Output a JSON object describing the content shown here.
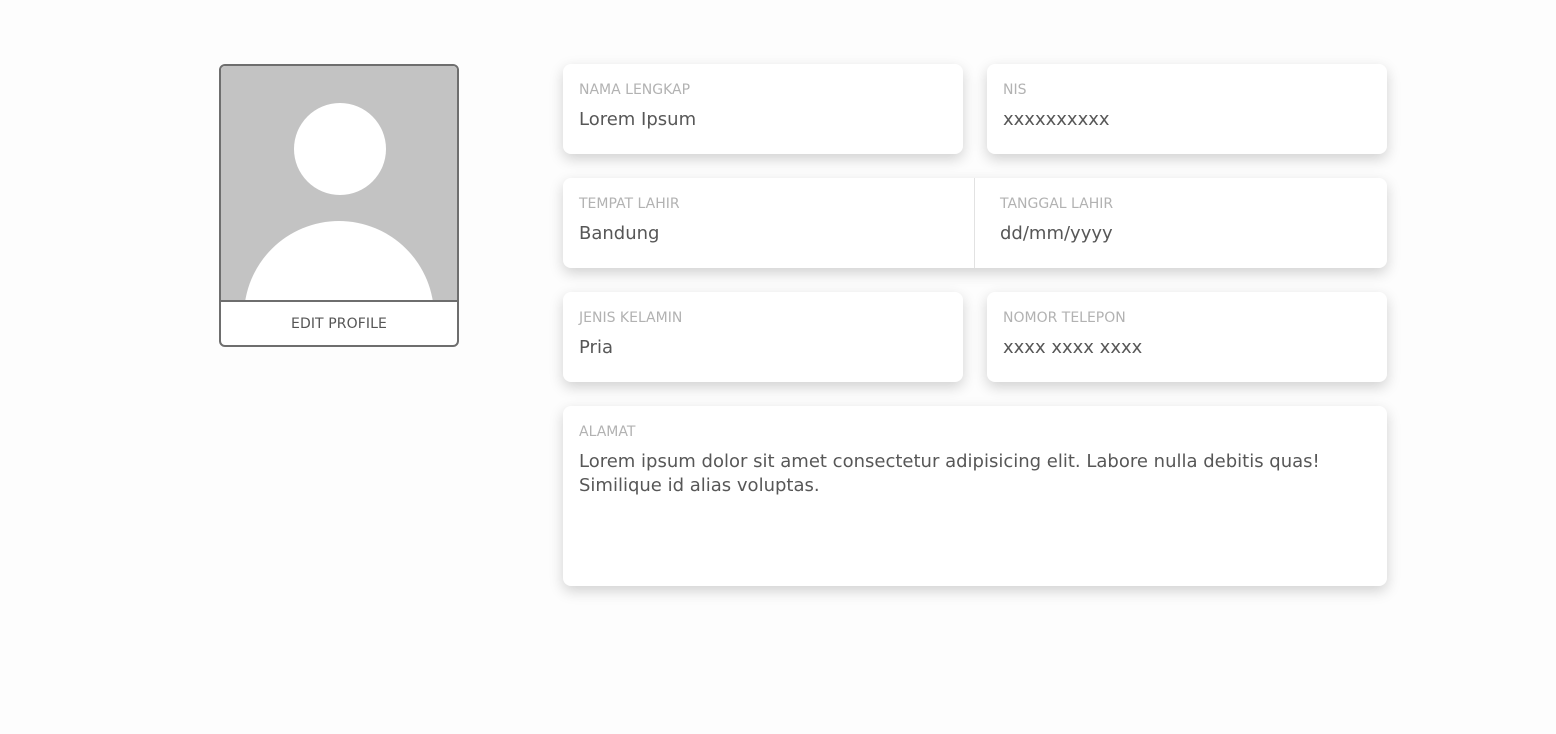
{
  "profile": {
    "edit_label": "EDIT PROFILE"
  },
  "fields": {
    "nama": {
      "label": "NAMA LENGKAP",
      "value": "Lorem Ipsum"
    },
    "nis": {
      "label": "NIS",
      "value": "xxxxxxxxxx"
    },
    "tempat": {
      "label": "TEMPAT LAHIR",
      "value": "Bandung"
    },
    "tanggal": {
      "label": "TANGGAL LAHIR",
      "value": "dd/mm/yyyy"
    },
    "kelamin": {
      "label": "JENIS KELAMIN",
      "value": "Pria"
    },
    "telepon": {
      "label": "NOMOR TELEPON",
      "value": "xxxx xxxx xxxx"
    },
    "alamat": {
      "label": "ALAMAT",
      "value": "Lorem ipsum dolor sit amet consectetur adipisicing elit. Labore nulla debitis quas! Similique id alias voluptas."
    }
  }
}
